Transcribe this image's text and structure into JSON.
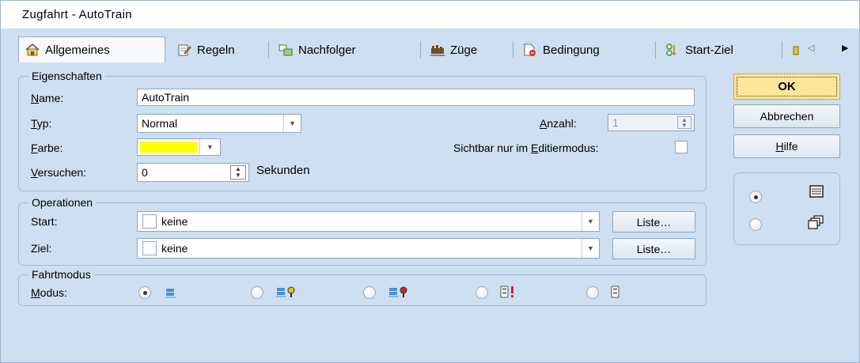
{
  "window": {
    "title": "Zugfahrt - AutoTrain"
  },
  "tabs": [
    {
      "label": "Allgemeines",
      "icon": "house-icon"
    },
    {
      "label": "Regeln",
      "icon": "rules-icon"
    },
    {
      "label": "Nachfolger",
      "icon": "successor-icon"
    },
    {
      "label": "Züge",
      "icon": "trains-icon"
    },
    {
      "label": "Bedingung",
      "icon": "condition-icon"
    },
    {
      "label": "Start-Ziel",
      "icon": "start-goal-icon"
    }
  ],
  "tab_scroll": {
    "left": "◁",
    "right": "▶"
  },
  "eigenschaften": {
    "title": "Eigenschaften",
    "name_label": "Name:",
    "name_value": "AutoTrain",
    "typ_label": "Typ:",
    "typ_value": "Normal",
    "farbe_label": "Farbe:",
    "farbe_color": "#ffff00",
    "versuchen_label": "Versuchen:",
    "versuchen_value": "0",
    "sekunden_label": "Sekunden",
    "anzahl_label": "Anzahl:",
    "anzahl_value": "1",
    "sichtbar_label": "Sichtbar nur im Editiermodus:"
  },
  "operationen": {
    "title": "Operationen",
    "start_label": "Start:",
    "start_value": "keine",
    "ziel_label": "Ziel:",
    "ziel_value": "keine",
    "liste_label": "Liste…"
  },
  "fahrtmodus": {
    "title": "Fahrtmodus",
    "modus_label": "Modus:",
    "options": [
      {
        "icon": "block-icon",
        "selected": true
      },
      {
        "icon": "block-key-icon",
        "selected": false
      },
      {
        "icon": "block-red-key-icon",
        "selected": false
      },
      {
        "icon": "signal-exclaim-icon",
        "selected": false
      },
      {
        "icon": "signal-icon",
        "selected": false
      }
    ]
  },
  "buttons": {
    "ok": "OK",
    "cancel": "Abbrechen",
    "help": "Hilfe"
  },
  "view_toggle": {
    "options": [
      {
        "icon": "list-view-icon",
        "selected": true
      },
      {
        "icon": "cascade-view-icon",
        "selected": false
      }
    ]
  }
}
